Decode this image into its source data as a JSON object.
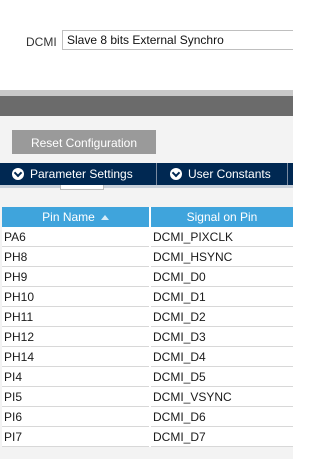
{
  "mode": {
    "label": "DCMI",
    "value": "Slave 8 bits External Synchro"
  },
  "toolbar": {
    "reset_label": "Reset Configuration"
  },
  "tabs": [
    {
      "label": "Parameter Settings",
      "icon": "check-circle-icon"
    },
    {
      "label": "User Constants",
      "icon": "check-circle-icon"
    }
  ],
  "table": {
    "columns": [
      "Pin Name",
      "Signal on Pin"
    ],
    "sort_icon": "sort-ascending-icon",
    "rows": [
      [
        "PA6",
        "DCMI_PIXCLK"
      ],
      [
        "PH8",
        "DCMI_HSYNC"
      ],
      [
        "PH9",
        "DCMI_D0"
      ],
      [
        "PH10",
        "DCMI_D1"
      ],
      [
        "PH11",
        "DCMI_D2"
      ],
      [
        "PH12",
        "DCMI_D3"
      ],
      [
        "PH14",
        "DCMI_D4"
      ],
      [
        "PI4",
        "DCMI_D5"
      ],
      [
        "PI5",
        "DCMI_VSYNC"
      ],
      [
        "PI6",
        "DCMI_D6"
      ],
      [
        "PI7",
        "DCMI_D7"
      ]
    ]
  },
  "colors": {
    "tab_bar": "#002852",
    "header": "#3fa4dc",
    "button": "#9a9a9a",
    "dark_bar": "#6b6b6b"
  }
}
